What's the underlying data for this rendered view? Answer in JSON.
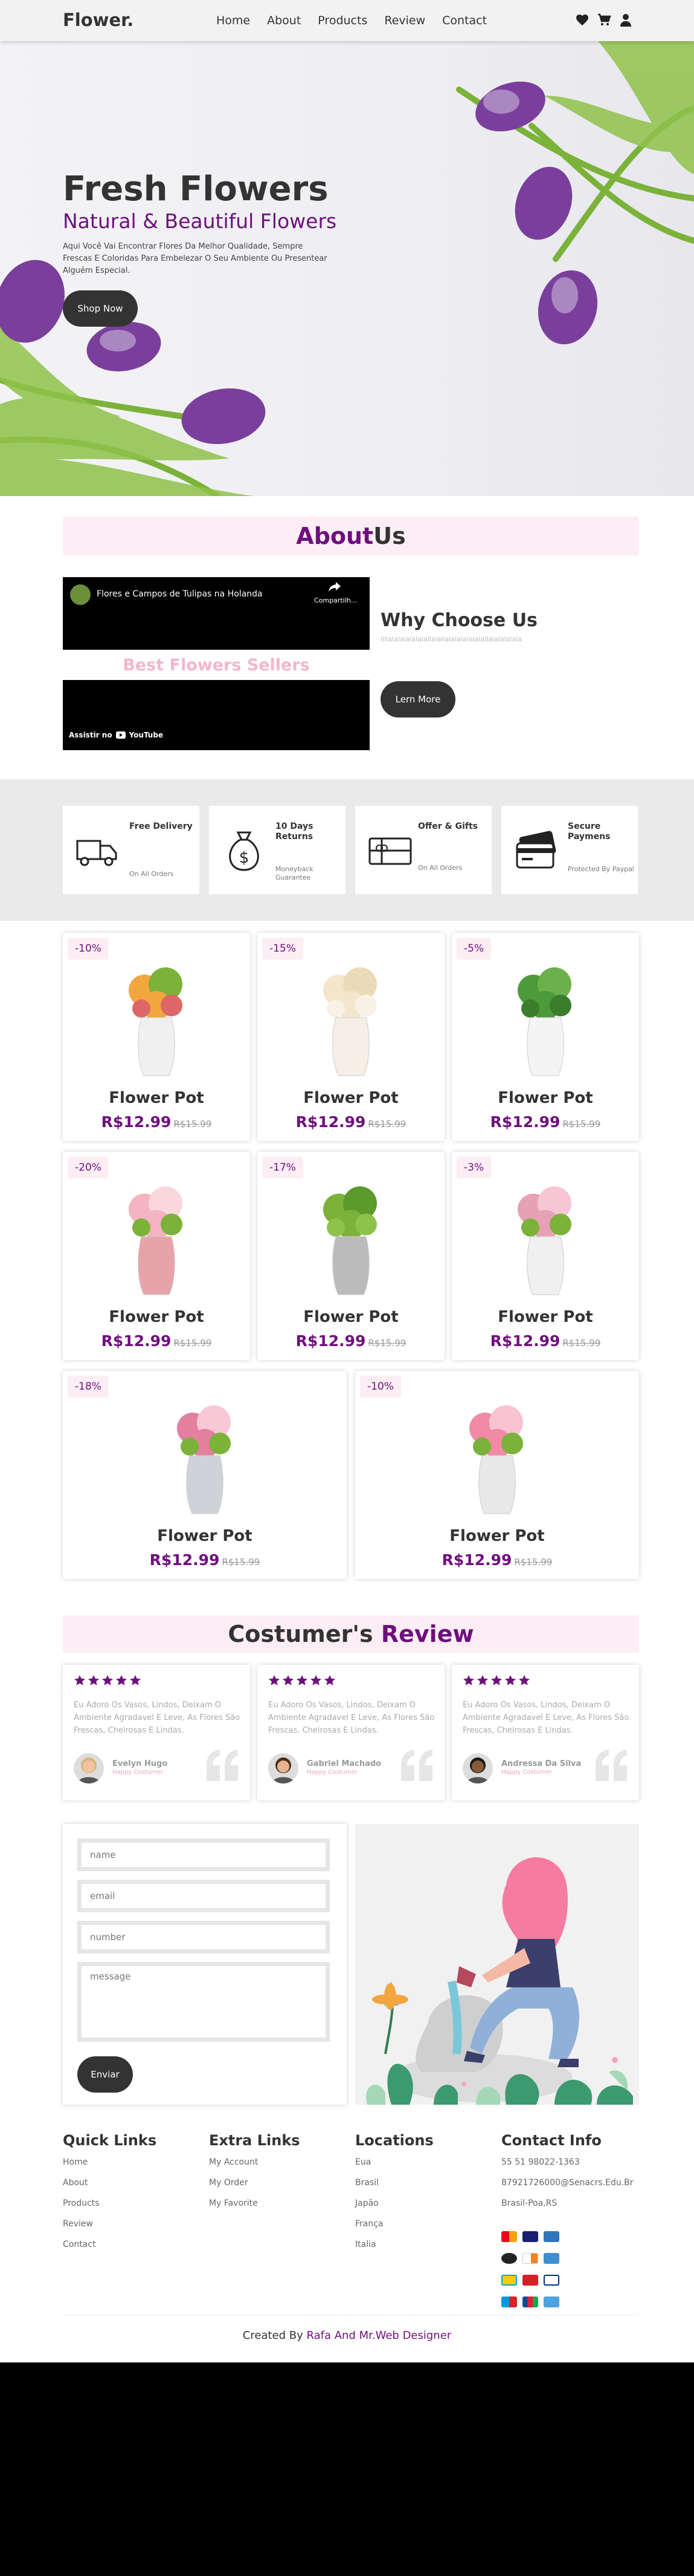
{
  "nav": {
    "logo": "Flower.",
    "links": [
      "Home",
      "About",
      "Products",
      "Review",
      "Contact"
    ],
    "icons": [
      "heart-icon",
      "cart-icon",
      "user-icon"
    ]
  },
  "hero": {
    "title": "Fresh Flowers",
    "subtitle": "Natural & Beautiful Flowers",
    "text": "Aqui Você Vai Encontrar Flores Da Melhor Qualidade, Sempre Frescas E Coloridas Para Embelezar O Seu Ambiente Ou Presentear Alguém Especial.",
    "button": "Shop Now"
  },
  "about": {
    "title_a": "About",
    "title_b": "Us",
    "video_title": "Flores e Campos de Tulipas na Holanda",
    "share": "Compartilh...",
    "watch": "Assistir no",
    "youtube": "YouTube",
    "best": "Best Flowers Sellers",
    "why": "Why Choose Us",
    "why_text": "llllalalalalalalallalallalalalalalalallalalalalala",
    "button": "Lern More"
  },
  "services": [
    {
      "title": "Free Delivery",
      "sub": "On All Orders",
      "icon": "truck-icon"
    },
    {
      "title": "10 Days Returns",
      "sub": "Moneyback Guarantee",
      "icon": "money-bag-icon"
    },
    {
      "title": "Offer & Gifts",
      "sub": "On All Orders",
      "icon": "gift-card-icon"
    },
    {
      "title": "Secure Paymens",
      "sub": "Protected By Paypal",
      "icon": "credit-card-icon"
    }
  ],
  "products": [
    {
      "discount": "-10%",
      "name": "Flower Pot",
      "price": "R$12.99",
      "old": "R$15.99"
    },
    {
      "discount": "-15%",
      "name": "Flower Pot",
      "price": "R$12.99",
      "old": "R$15.99"
    },
    {
      "discount": "-5%",
      "name": "Flower Pot",
      "price": "R$12.99",
      "old": "R$15.99"
    },
    {
      "discount": "-20%",
      "name": "Flower Pot",
      "price": "R$12.99",
      "old": "R$15.99"
    },
    {
      "discount": "-17%",
      "name": "Flower Pot",
      "price": "R$12.99",
      "old": "R$15.99"
    },
    {
      "discount": "-3%",
      "name": "Flower Pot",
      "price": "R$12.99",
      "old": "R$15.99"
    },
    {
      "discount": "-18%",
      "name": "Flower Pot",
      "price": "R$12.99",
      "old": "R$15.99"
    },
    {
      "discount": "-10%",
      "name": "Flower Pot",
      "price": "R$12.99",
      "old": "R$15.99"
    }
  ],
  "review": {
    "title_a": "Costumer's",
    "title_b": "Review",
    "items": [
      {
        "text": "Eu Adoro Os Vasos, Lindos, Deixam O Ambiente Agradavel E Leve, As Flores São Frescas, Cheirosas E Lindas.",
        "name": "Evelyn Hugo",
        "role": "Happy Costumer",
        "rating": 5
      },
      {
        "text": "Eu Adoro Os Vasos, Lindos, Deixam O Ambiente Agradavel E Leve, As Flores São Frescas, Cheirosas E Lindas.",
        "name": "Gabriel Machado",
        "role": "Happy Costumer",
        "rating": 5
      },
      {
        "text": "Eu Adoro Os Vasos, Lindos, Deixam O Ambiente Agradavel E Leve, As Flores São Frescas, Cheirosas E Lindas.",
        "name": "Andressa Da Silva",
        "role": "Happy Costumer",
        "rating": 5
      }
    ]
  },
  "form": {
    "name": "name",
    "email": "email",
    "number": "number",
    "message": "message",
    "button": "Enviar"
  },
  "footer": {
    "quick": {
      "title": "Quick Links",
      "items": [
        "Home",
        "About",
        "Products",
        "Review",
        "Contact"
      ]
    },
    "extra": {
      "title": "Extra Links",
      "items": [
        "My Account",
        "My Order",
        "My Favorite"
      ]
    },
    "loc": {
      "title": "Locations",
      "items": [
        "Eua",
        "Brasil",
        "Japão",
        "França",
        "Italia"
      ]
    },
    "contact": {
      "title": "Contact Info",
      "items": [
        "55 51 98022-1363",
        "87921726000@Senacrs.Edu.Br",
        "Brasil-Poa,RS"
      ]
    },
    "credit_a": "Created By",
    "credit_b": "Rafa And Mr.Web Designer"
  },
  "colors": {
    "accent": "#6e0f7d",
    "pink": "#fdeef5",
    "dark": "#333333"
  }
}
